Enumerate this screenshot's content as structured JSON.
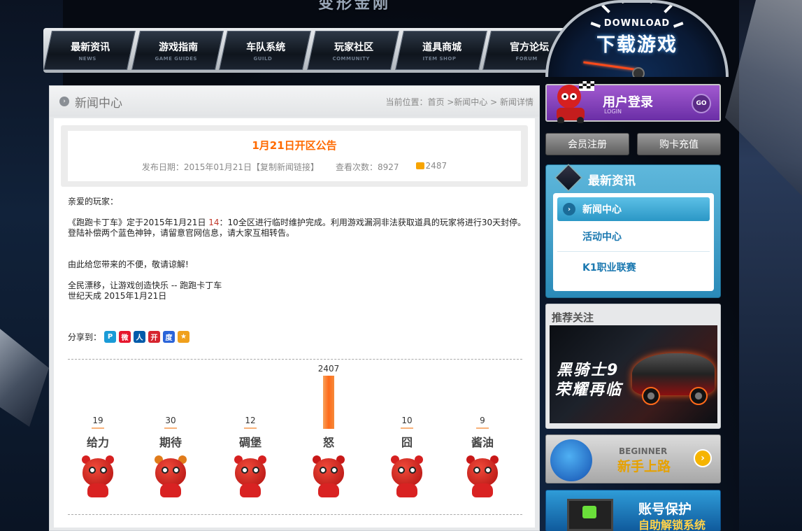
{
  "logo": {
    "text": "变形金刚"
  },
  "nav": {
    "items": [
      {
        "label": "最新资讯",
        "sub": "NEWS"
      },
      {
        "label": "游戏指南",
        "sub": "GAME GUIDES"
      },
      {
        "label": "车队系统",
        "sub": "GUILD"
      },
      {
        "label": "玩家社区",
        "sub": "COMMUNITY"
      },
      {
        "label": "道具商城",
        "sub": "ITEM SHOP"
      },
      {
        "label": "官方论坛",
        "sub": "FORUM"
      }
    ]
  },
  "download": {
    "en": "DOWNLOAD",
    "cn": "下载游戏"
  },
  "main": {
    "title": "新闻中心",
    "breadcrumb": "当前位置：首页 >新闻中心 > 新闻详情"
  },
  "article": {
    "title": "1月21日开区公告",
    "publish_label": "发布日期：2015年01月21日",
    "copy_link": "【复制新闻链接】",
    "views": "查看次数：8927",
    "comments": "2487",
    "greeting": "亲爱的玩家：",
    "para1_pre": "《跑跑卡丁车》定于2015年1月21日 ",
    "para1_hl": "14",
    "para1_post": "：10全区进行临时维护完成。利用游戏漏洞非法获取道具的玩家将进行30天封停。",
    "para2": "登陆补偿两个蓝色神钟，请留意官网信息，请大家互相转告。",
    "apology": "由此给您带来的不便，敬请谅解!",
    "slogan": "全民漂移，让游戏创造快乐 -- 跑跑卡丁车",
    "sign": "世纪天成 2015年1月21日",
    "share_label": "分享到："
  },
  "share_icons": [
    {
      "name": "share-qzone-icon",
      "glyph": "P",
      "color": "#1a9bd7"
    },
    {
      "name": "share-weibo-icon",
      "glyph": "微",
      "color": "#e6162d"
    },
    {
      "name": "share-renren-icon",
      "glyph": "人",
      "color": "#005baa"
    },
    {
      "name": "share-kaixin-icon",
      "glyph": "开",
      "color": "#d6242f"
    },
    {
      "name": "share-baidu-icon",
      "glyph": "度",
      "color": "#2b64d9"
    },
    {
      "name": "share-favorite-icon",
      "glyph": "★",
      "color": "#f0a01c"
    }
  ],
  "chart_data": {
    "type": "bar",
    "categories": [
      "给力",
      "期待",
      "碉堡",
      "怒",
      "囧",
      "酱油"
    ],
    "values": [
      19,
      30,
      12,
      2407,
      10,
      9
    ],
    "ylim": [
      0,
      2407
    ]
  },
  "sidebar": {
    "login_title": "用户登录",
    "login_sub": "LOGIN",
    "go": "GO",
    "register": "会员注册",
    "recharge": "购卡充值",
    "news_title": "最新资讯",
    "news_items": [
      "新闻中心",
      "活动中心",
      "K1职业联赛"
    ],
    "recommend_title": "推荐关注",
    "recommend_line1": "黑骑士9",
    "recommend_line2": "荣耀再临",
    "beginner_en": "BEGINNER",
    "beginner_cn": "新手上路",
    "account_t1": "账号保护",
    "account_t2": "自助解锁系统"
  },
  "colors": {
    "accent_orange": "#ff6a00",
    "nav_bg": "#0f151d",
    "login_purple": "#6a2ea6",
    "news_blue": "#2a8ab8"
  }
}
